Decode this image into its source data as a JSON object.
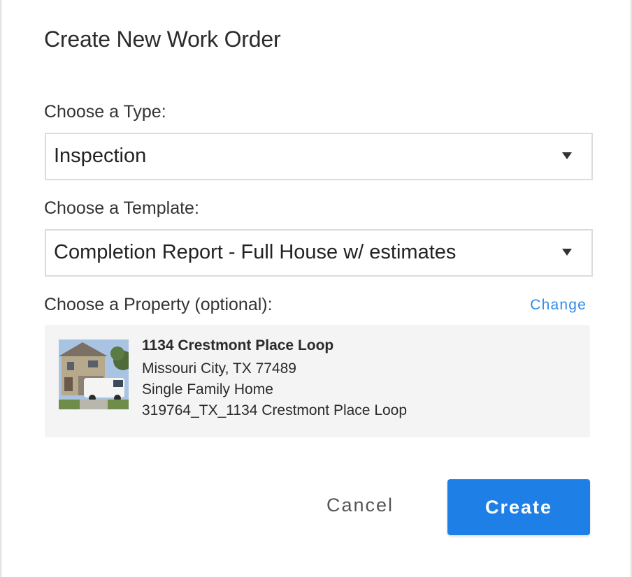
{
  "dialog": {
    "title": "Create New Work Order"
  },
  "type_field": {
    "label": "Choose a Type:",
    "selected": "Inspection"
  },
  "template_field": {
    "label": "Choose a Template:",
    "selected": "Completion Report - Full House w/ estimates"
  },
  "property_field": {
    "label": "Choose a Property (optional):",
    "change_label": "Change",
    "property": {
      "name": "1134 Crestmont Place Loop",
      "city_line": "Missouri City, TX 77489",
      "type": "Single Family Home",
      "id_line": "319764_TX_1134 Crestmont Place Loop"
    }
  },
  "actions": {
    "cancel_label": "Cancel",
    "create_label": "Create"
  },
  "colors": {
    "accent": "#1e80e6",
    "link": "#2e8be8",
    "card_bg": "#f4f4f4"
  }
}
